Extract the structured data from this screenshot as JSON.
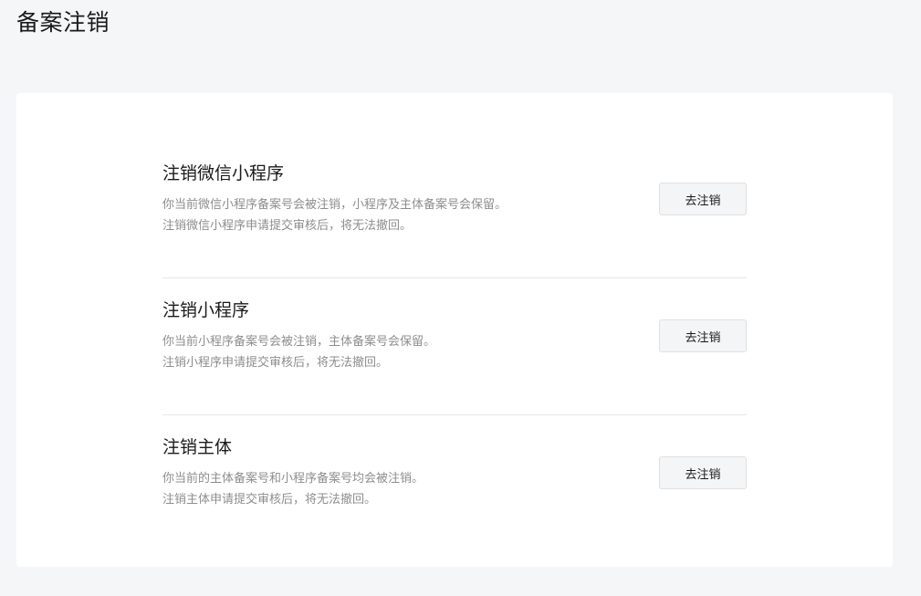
{
  "page": {
    "title": "备案注销"
  },
  "items": [
    {
      "title": "注销微信小程序",
      "desc_line1": "你当前微信小程序备案号会被注销，小程序及主体备案号会保留。",
      "desc_line2": "注销微信小程序申请提交审核后，将无法撤回。",
      "button_label": "去注销"
    },
    {
      "title": "注销小程序",
      "desc_line1": "你当前小程序备案号会被注销，主体备案号会保留。",
      "desc_line2": "注销小程序申请提交审核后，将无法撤回。",
      "button_label": "去注销"
    },
    {
      "title": "注销主体",
      "desc_line1": "你当前的主体备案号和小程序备案号均会被注销。",
      "desc_line2": "注销主体申请提交审核后，将无法撤回。",
      "button_label": "去注销"
    }
  ]
}
